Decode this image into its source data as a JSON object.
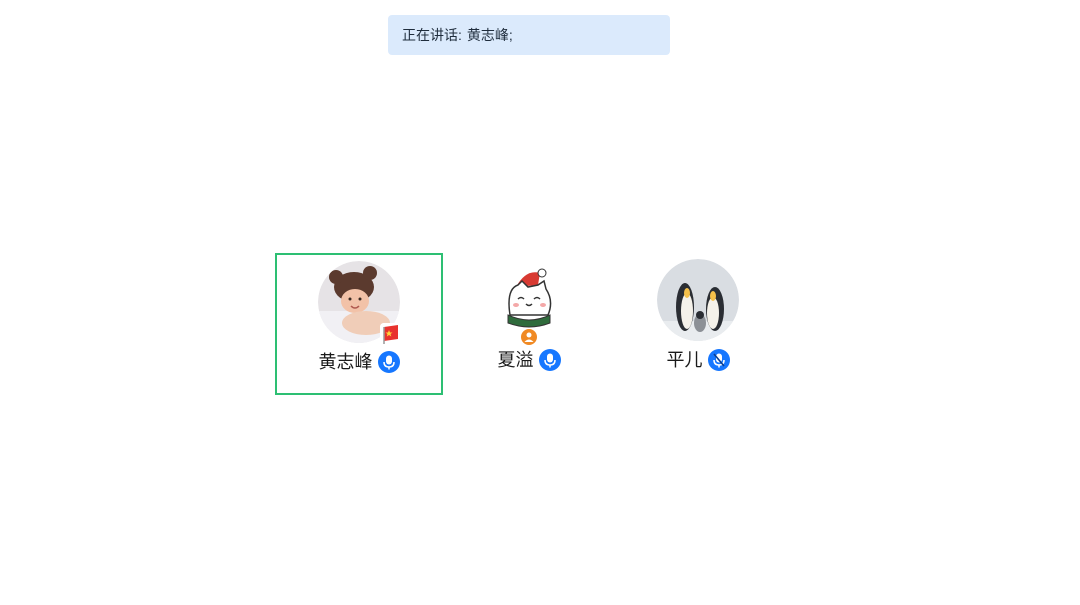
{
  "banner": {
    "prefix": "正在讲话:",
    "speaker": "黄志峰;"
  },
  "participants": [
    {
      "name": "黄志峰",
      "active": true,
      "avatar": "baby-photo",
      "badge": "flag-icon",
      "mic": "mic-icon",
      "mic_color": "#1677ff"
    },
    {
      "name": "夏溢",
      "active": false,
      "avatar": "cartoon-cat",
      "badge": "user-role-icon",
      "mic": "mic-icon",
      "mic_color": "#1677ff"
    },
    {
      "name": "平儿",
      "active": false,
      "avatar": "penguins-photo",
      "badge": "",
      "mic": "mic-muted-icon",
      "mic_color": "#1677ff"
    }
  ],
  "colors": {
    "active_border": "#2dbf73",
    "banner_bg": "#dbeafc",
    "mic_blue": "#1677ff"
  }
}
